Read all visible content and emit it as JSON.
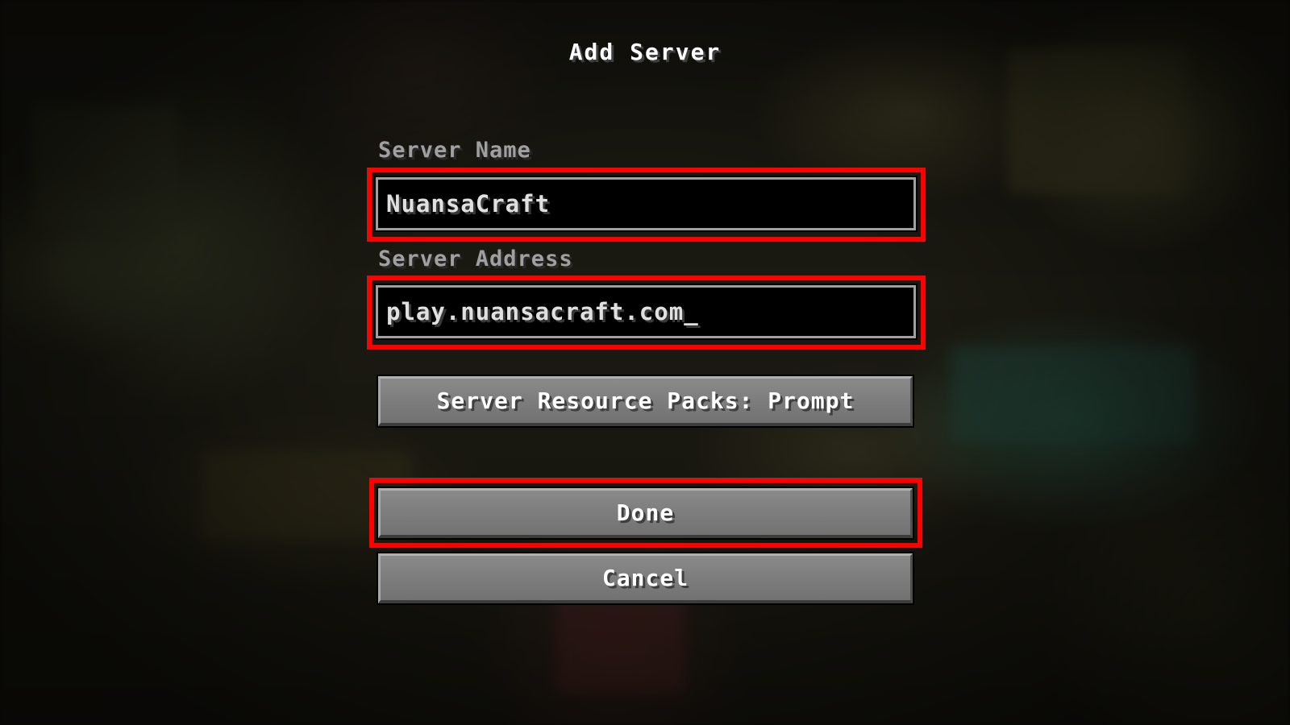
{
  "screen": {
    "title": "Add Server"
  },
  "form": {
    "server_name_label": "Server Name",
    "server_name_value": "NuansaCraft",
    "server_address_label": "Server Address",
    "server_address_value": "play.nuansacraft.com",
    "text_cursor": "_"
  },
  "buttons": {
    "resource_packs_label": "Server Resource Packs: Prompt",
    "done_label": "Done",
    "cancel_label": "Cancel"
  },
  "colors": {
    "highlight": "#ff0000",
    "field_background": "#000000",
    "label_text": "#a0a0a0",
    "button_face": "#7d7d7d"
  }
}
